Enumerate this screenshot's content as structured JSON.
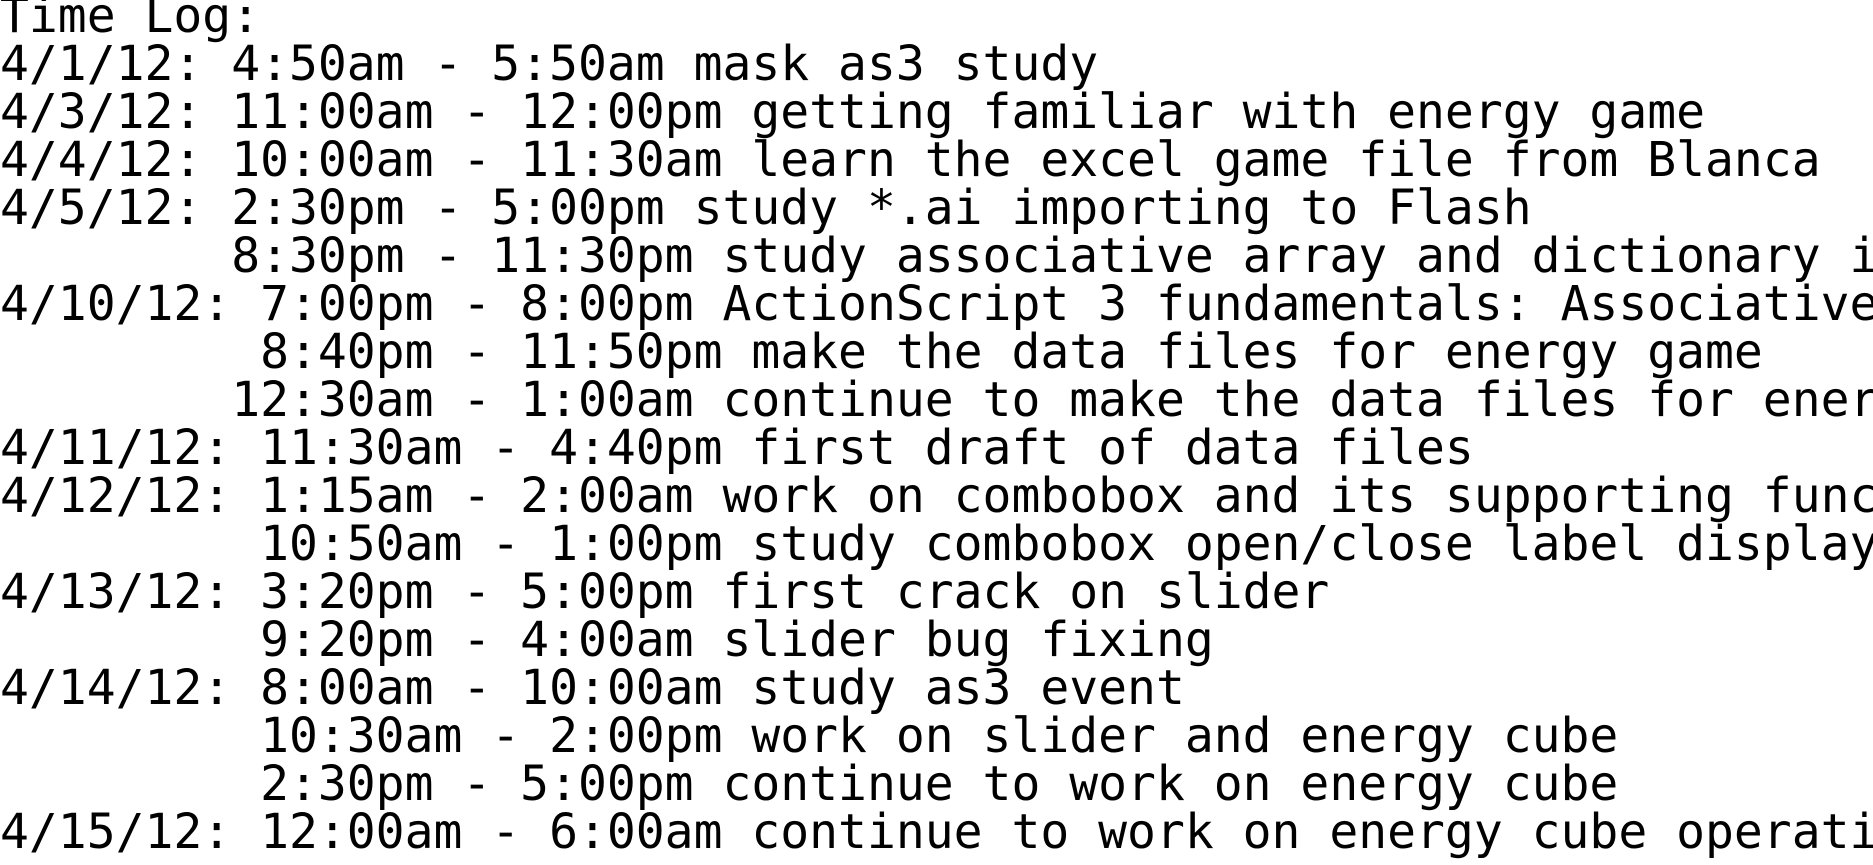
{
  "document": {
    "lines": [
      "Time Log:",
      "4/1/12: 4:50am - 5:50am mask as3 study",
      "4/3/12: 11:00am - 12:00pm getting familiar with energy game",
      "4/4/12: 10:00am - 11:30am learn the excel game file from Blanca",
      "4/5/12: 2:30pm - 5:00pm study *.ai importing to Flash",
      "        8:30pm - 11:30pm study associative array and dictionary i",
      "4/10/12: 7:00pm - 8:00pm ActionScript 3 fundamentals: Associative",
      "         8:40pm - 11:50pm make the data files for energy game",
      "        12:30am - 1:00am continue to make the data files for ener",
      "4/11/12: 11:30am - 4:40pm first draft of data files",
      "4/12/12: 1:15am - 2:00am work on combobox and its supporting func",
      "         10:50am - 1:00pm study combobox open/close label display",
      "4/13/12: 3:20pm - 5:00pm first crack on slider",
      "         9:20pm - 4:00am slider bug fixing",
      "4/14/12: 8:00am - 10:00am study as3 event",
      "         10:30am - 2:00pm work on slider and energy cube",
      "         2:30pm - 5:00pm continue to work on energy cube",
      "4/15/12: 12:00am - 6:00am continue to work on energy cube operati"
    ]
  }
}
